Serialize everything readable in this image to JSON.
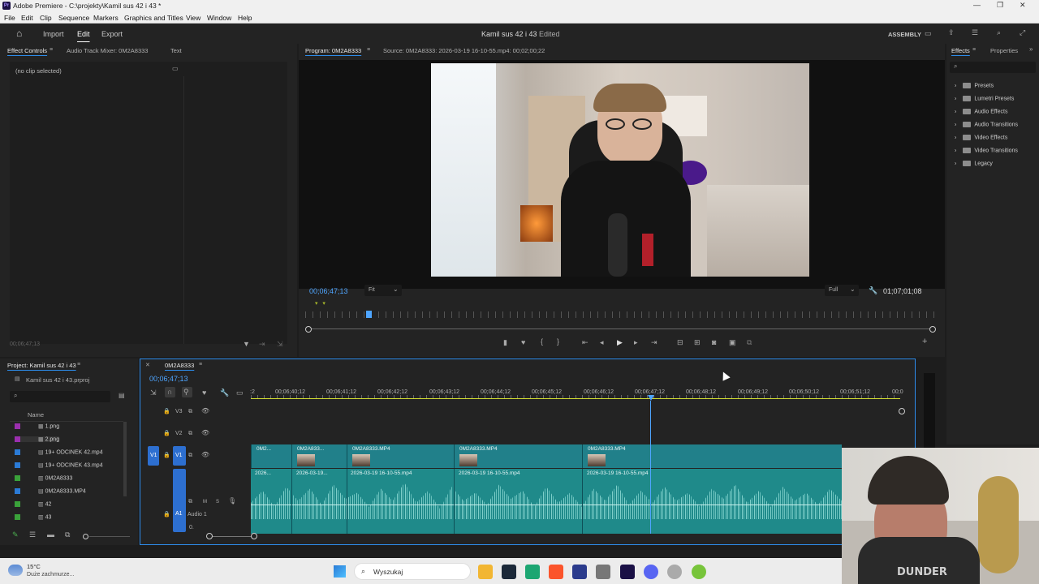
{
  "window": {
    "title": "Adobe Premiere - C:\\projekty\\Kamil sus 42 i 43 *",
    "logo": "Pr"
  },
  "menu": [
    "File",
    "Edit",
    "Clip",
    "Sequence",
    "Markers",
    "Graphics and Titles",
    "View",
    "Window",
    "Help"
  ],
  "header": {
    "nav": [
      "Import",
      "Edit",
      "Export"
    ],
    "project_title": "Kamil sus 42 i 43",
    "status": "Edited",
    "workspace": "ASSEMBLY"
  },
  "effect_controls": {
    "tabs": [
      "Effect Controls",
      "Audio Track Mixer: 0M2A8333",
      "Text"
    ],
    "empty_msg": "(no clip selected)",
    "timecode": "00;06;47;13"
  },
  "program": {
    "tab": "Program: 0M2A8333",
    "source": "Source: 0M2A8333: 2026-03-19 16-10-55.mp4: 00;02;00;22",
    "timecode": "00;06;47;13",
    "fit": "Fit",
    "quality": "Full",
    "duration": "01;07;01;08"
  },
  "effects": {
    "tabs": [
      "Effects",
      "Properties"
    ],
    "items": [
      "Presets",
      "Lumetri Presets",
      "Audio Effects",
      "Audio Transitions",
      "Video Effects",
      "Video Transitions",
      "Legacy"
    ]
  },
  "project": {
    "tab": "Project: Kamil sus 42 i 43",
    "file": "Kamil sus 42 i 43.prproj",
    "col_name": "Name",
    "items": [
      {
        "name": "1.png",
        "color": "#9b2fae"
      },
      {
        "name": "2.png",
        "color": "#9b2fae"
      },
      {
        "name": "19+ ODCINEK 42.mp4",
        "color": "#2b7bd6"
      },
      {
        "name": "19+ ODCINEK 43.mp4",
        "color": "#2b7bd6"
      },
      {
        "name": "0M2A8333",
        "color": "#3aa23a"
      },
      {
        "name": "0M2A8333.MP4",
        "color": "#2b7bd6"
      },
      {
        "name": "42",
        "color": "#3aa23a"
      },
      {
        "name": "43",
        "color": "#3aa23a"
      }
    ]
  },
  "timeline": {
    "tab": "0M2A8333",
    "timecode": "00;06;47;13",
    "ruler": [
      ":2",
      "00;06;40;12",
      "00;06;41;12",
      "00;06;42;12",
      "00;06;43;12",
      "00;06;44;12",
      "00;06;45;12",
      "00;06;46;12",
      "00;06;47;12",
      "00;06;48;12",
      "00;06;49;12",
      "00;06;50;12",
      "00;06;51;12",
      "00;0"
    ],
    "tracks": [
      "V3",
      "V2",
      "V1",
      "A1"
    ],
    "audio_track_name": "Audio 1",
    "video_clips": [
      "0M2...",
      "0M2A833...",
      "0M2A8333.MP4",
      "0M2A8333.MP4",
      "0M2A8333.MP4"
    ],
    "audio_clips": [
      "2026...",
      "2026-03-19...",
      "2026-03-19 16-10-55.mp4",
      "2026-03-19 16-10-55.mp4",
      "2026-03-19 16-10-55.mp4"
    ]
  },
  "taskbar": {
    "weather_temp": "15°C",
    "weather_desc": "Duże zachmurze...",
    "search": "Wyszukaj"
  },
  "colors": {
    "accent": "#2d8ceb",
    "clip": "#21808a",
    "playhead": "#4ea5ff"
  }
}
